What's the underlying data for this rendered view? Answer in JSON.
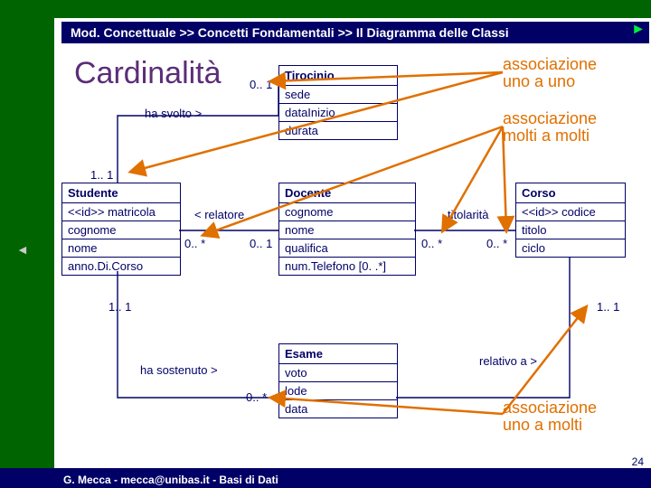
{
  "breadcrumb": "Mod. Concettuale >> Concetti Fondamentali >> Il Diagramma delle Classi",
  "title": "Cardinalità",
  "annotations": {
    "one_to_one": "associazione\nuno a uno",
    "many_to_many": "associazione\nmolti a molti",
    "one_to_many": "associazione\nuno a molti"
  },
  "classes": {
    "tirocinio": {
      "name": "Tirocinio",
      "attrs": [
        "sede",
        "dataInizio",
        "durata"
      ]
    },
    "studente": {
      "name": "Studente",
      "attrs": [
        "<<id>> matricola",
        "cognome",
        "nome",
        "anno.Di.Corso"
      ]
    },
    "docente": {
      "name": "Docente",
      "attrs": [
        "cognome",
        "nome",
        "qualifica",
        "num.Telefono [0. .*]"
      ]
    },
    "corso": {
      "name": "Corso",
      "attrs": [
        "<<id>> codice",
        "titolo",
        "ciclo"
      ]
    },
    "esame": {
      "name": "Esame",
      "attrs": [
        "voto",
        "lode",
        "data"
      ]
    }
  },
  "roles": {
    "ha_svolto": "ha svolto >",
    "relatore": "< relatore",
    "titolarita": "titolarità",
    "ha_sostenuto": "ha sostenuto >",
    "relativo_a": "relativo a >"
  },
  "cards": {
    "c01": "0.. 1",
    "c11s": "1.. 1",
    "c0s_a": "0.. *",
    "c0s_b": "0.. *",
    "c0s_c": "0.. *",
    "c01b": "0.. 1",
    "c0s_d": "0.. *",
    "c11b": "1.. 1",
    "c11c": "1.. 1"
  },
  "footer": "G. Mecca - mecca@unibas.it - Basi di Dati",
  "page": "24",
  "nav": {
    "prev": "◄",
    "next": "►"
  }
}
